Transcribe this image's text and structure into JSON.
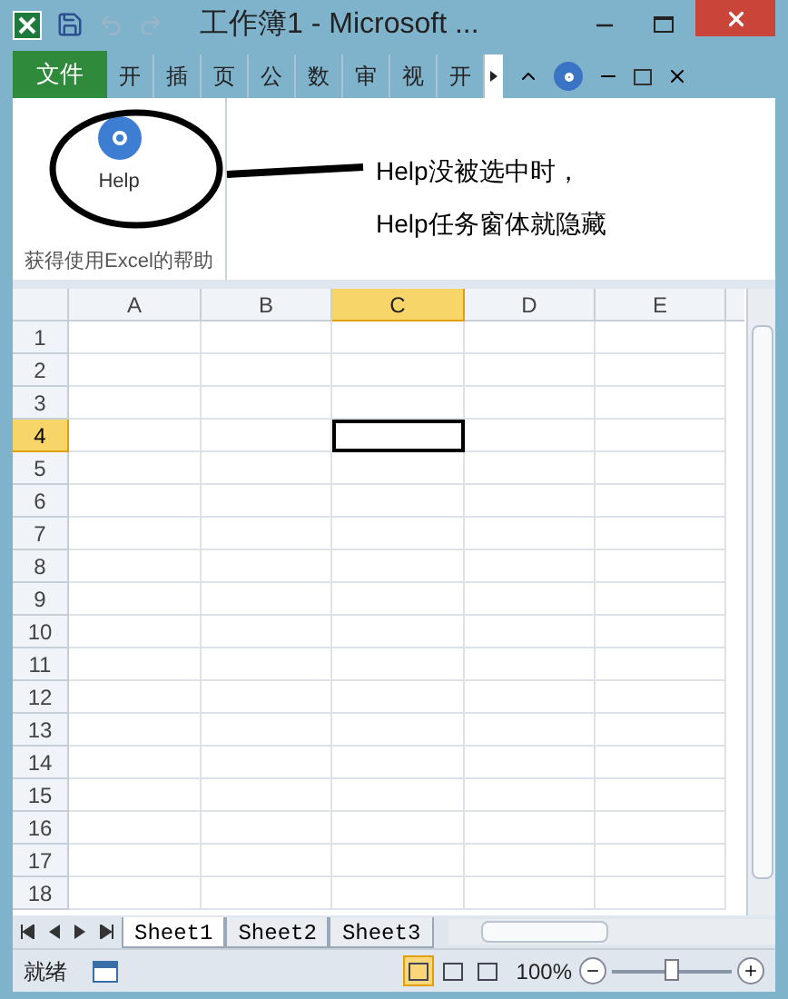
{
  "window": {
    "title": "工作簿1 - Microsoft ..."
  },
  "ribbon_tabs": [
    {
      "label": "文件",
      "kind": "file",
      "selected": false
    },
    {
      "label": "开",
      "kind": "tab",
      "selected": false
    },
    {
      "label": "插",
      "kind": "tab",
      "selected": false
    },
    {
      "label": "页",
      "kind": "tab",
      "selected": false
    },
    {
      "label": "公",
      "kind": "tab",
      "selected": false
    },
    {
      "label": "数",
      "kind": "tab",
      "selected": false
    },
    {
      "label": "审",
      "kind": "tab",
      "selected": false
    },
    {
      "label": "视",
      "kind": "tab",
      "selected": false
    },
    {
      "label": "开",
      "kind": "tab",
      "selected": false
    }
  ],
  "ribbon": {
    "button": {
      "label": "Help"
    },
    "group_label": "获得使用Excel的帮助"
  },
  "annotation": {
    "lines": [
      "Help没被选中时，",
      "Help任务窗体就隐藏"
    ]
  },
  "sheet": {
    "columns": [
      {
        "label": "A",
        "selected": false
      },
      {
        "label": "B",
        "selected": false
      },
      {
        "label": "C",
        "selected": true
      },
      {
        "label": "D",
        "selected": false
      },
      {
        "label": "E",
        "selected": false
      }
    ],
    "rows": [
      {
        "label": "1",
        "selected": false
      },
      {
        "label": "2",
        "selected": false
      },
      {
        "label": "3",
        "selected": false
      },
      {
        "label": "4",
        "selected": true
      },
      {
        "label": "5",
        "selected": false
      },
      {
        "label": "6",
        "selected": false
      },
      {
        "label": "7",
        "selected": false
      },
      {
        "label": "8",
        "selected": false
      },
      {
        "label": "9",
        "selected": false
      },
      {
        "label": "10",
        "selected": false
      },
      {
        "label": "11",
        "selected": false
      },
      {
        "label": "12",
        "selected": false
      },
      {
        "label": "13",
        "selected": false
      },
      {
        "label": "14",
        "selected": false
      },
      {
        "label": "15",
        "selected": false
      },
      {
        "label": "16",
        "selected": false
      },
      {
        "label": "17",
        "selected": false
      },
      {
        "label": "18",
        "selected": false
      }
    ]
  },
  "sheet_tabs": [
    {
      "label": "Sheet1",
      "selected": true
    },
    {
      "label": "Sheet2",
      "selected": false
    },
    {
      "label": "Sheet3",
      "selected": false
    }
  ],
  "status_bar": {
    "status": "就绪",
    "views": [
      {
        "selected": true
      },
      {
        "selected": false
      },
      {
        "selected": false
      }
    ],
    "zoom": "100%",
    "zoom_slider": {
      "level": 0.5
    }
  }
}
